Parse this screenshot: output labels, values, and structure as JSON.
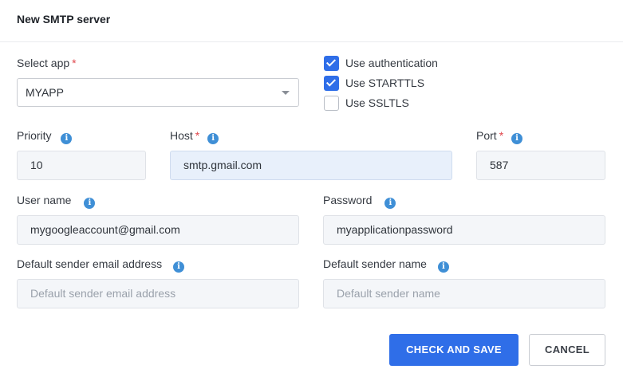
{
  "dialog": {
    "title": "New SMTP server"
  },
  "select_app": {
    "label": "Select app",
    "required_mark": "*",
    "value": "MYAPP"
  },
  "options": {
    "use_authentication": {
      "label": "Use authentication",
      "checked": true
    },
    "use_starttls": {
      "label": "Use STARTTLS",
      "checked": true
    },
    "use_ssltls": {
      "label": "Use SSLTLS",
      "checked": false
    }
  },
  "priority": {
    "label": "Priority",
    "value": "10"
  },
  "host": {
    "label": "Host",
    "required_mark": "*",
    "value": "smtp.gmail.com"
  },
  "port": {
    "label": "Port",
    "required_mark": "*",
    "value": "587"
  },
  "username": {
    "label": "User name",
    "value": "mygoogleaccount@gmail.com"
  },
  "password": {
    "label": "Password",
    "value": "myapplicationpassword"
  },
  "sender_email": {
    "label": "Default sender email address",
    "placeholder": "Default sender email address"
  },
  "sender_name": {
    "label": "Default sender name",
    "placeholder": "Default sender name"
  },
  "buttons": {
    "save": "CHECK AND SAVE",
    "cancel": "CANCEL"
  },
  "icons": {
    "info": "i"
  },
  "colors": {
    "primary": "#2f6ee8",
    "required": "#e0474c",
    "info": "#3f8fd6"
  }
}
